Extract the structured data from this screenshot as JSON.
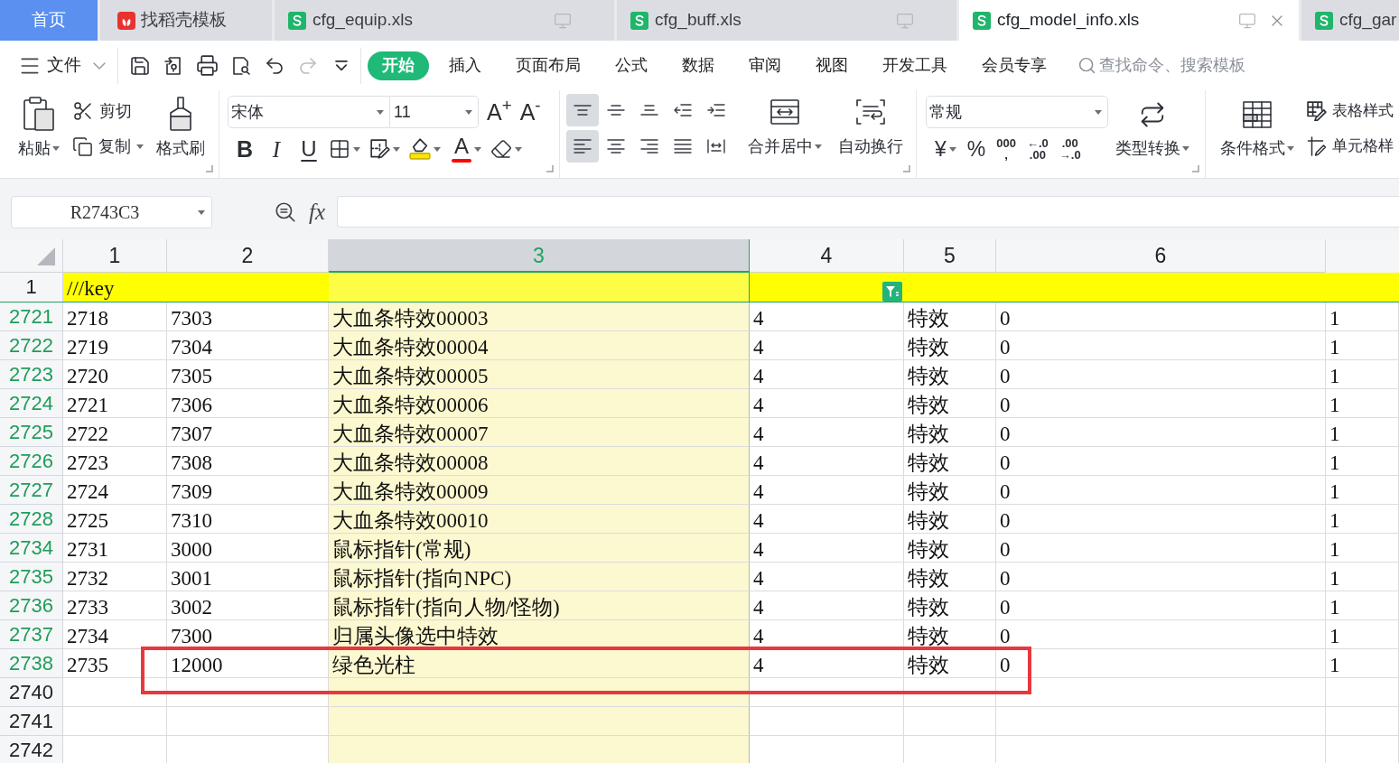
{
  "tabs": [
    {
      "kind": "home",
      "label": "首页",
      "selected": false
    },
    {
      "kind": "template",
      "label": "找稻壳模板",
      "selected": false
    },
    {
      "kind": "file",
      "label": "cfg_equip.xls",
      "selected": false
    },
    {
      "kind": "file",
      "label": "cfg_buff.xls",
      "selected": false
    },
    {
      "kind": "file",
      "label": "cfg_model_info.xls",
      "selected": true
    },
    {
      "kind": "file",
      "label": "cfg_gar",
      "selected": false
    }
  ],
  "menu_bar": {
    "file_menu": "文件",
    "history": [
      {
        "kind": "undo",
        "disabled": false
      },
      {
        "kind": "redo",
        "disabled": true
      }
    ],
    "items": [
      {
        "label": "开始",
        "selected": true
      },
      {
        "label": "插入",
        "selected": false
      },
      {
        "label": "页面布局",
        "selected": false
      },
      {
        "label": "公式",
        "selected": false
      },
      {
        "label": "数据",
        "selected": false
      },
      {
        "label": "审阅",
        "selected": false
      },
      {
        "label": "视图",
        "selected": false
      },
      {
        "label": "开发工具",
        "selected": false
      },
      {
        "label": "会员专享",
        "selected": false
      }
    ],
    "search": {
      "placeholder": "查找命令、搜索模板"
    }
  },
  "ribbon": {
    "clipboard": {
      "paste": "粘贴",
      "cut": "剪切",
      "copy": "复制",
      "format_painter": "格式刷"
    },
    "font": {
      "family": "宋体",
      "size": "11",
      "grow": "A$^{+}$",
      "shrink": "A$^{-}$",
      "bold": "B",
      "italic": "I",
      "underline": "U",
      "font_color": "A"
    },
    "alignment": {
      "buttons": [
        {
          "kind": "top",
          "selected": true
        },
        {
          "kind": "middle",
          "selected": false
        },
        {
          "kind": "bottom",
          "selected": false
        },
        {
          "kind": "outdent",
          "selected": false
        },
        {
          "kind": "indent",
          "selected": false
        },
        {
          "kind": "left",
          "selected": true
        },
        {
          "kind": "center",
          "selected": false
        },
        {
          "kind": "right",
          "selected": false
        },
        {
          "kind": "justify",
          "selected": false
        },
        {
          "kind": "distributed",
          "selected": false
        }
      ],
      "merge": "合并居中",
      "wrap": "自动换行"
    },
    "number": {
      "format": "常规",
      "buttons": [
        {
          "kind": "currency",
          "lines": [
            "¥"
          ]
        },
        {
          "kind": "percent",
          "lines": [
            "%"
          ]
        },
        {
          "kind": "thousands",
          "lines": [
            "000",
            ","
          ]
        },
        {
          "kind": "add_decimal",
          "lines": [
            "←.0",
            ".00"
          ]
        },
        {
          "kind": "remove_decimal",
          "lines": [
            ".00",
            "→.0"
          ]
        }
      ],
      "convert": "类型转换"
    },
    "styles": {
      "conditional": "条件格式",
      "table_style": "表格样式",
      "cell_style": "单元格样"
    }
  },
  "formula_bar": {
    "name_box": "R2743C3",
    "function_label": "fx"
  },
  "sheet": {
    "columns": [
      {
        "label": "1",
        "selected": false
      },
      {
        "label": "2",
        "selected": false
      },
      {
        "label": "3",
        "selected": true
      },
      {
        "label": "4",
        "selected": false
      },
      {
        "label": "5",
        "selected": false
      },
      {
        "label": "6",
        "selected": false
      }
    ],
    "header_row": {
      "number": "1",
      "key": "///key",
      "filter": true
    },
    "rows": [
      {
        "number": "2721",
        "filtered": true,
        "highlighted": false,
        "cells": [
          "2718",
          "7303",
          "大血条特效00003",
          "4",
          "特效",
          "0",
          "1"
        ]
      },
      {
        "number": "2722",
        "filtered": true,
        "highlighted": false,
        "cells": [
          "2719",
          "7304",
          "大血条特效00004",
          "4",
          "特效",
          "0",
          "1"
        ]
      },
      {
        "number": "2723",
        "filtered": true,
        "highlighted": false,
        "cells": [
          "2720",
          "7305",
          "大血条特效00005",
          "4",
          "特效",
          "0",
          "1"
        ]
      },
      {
        "number": "2724",
        "filtered": true,
        "highlighted": false,
        "cells": [
          "2721",
          "7306",
          "大血条特效00006",
          "4",
          "特效",
          "0",
          "1"
        ]
      },
      {
        "number": "2725",
        "filtered": true,
        "highlighted": false,
        "cells": [
          "2722",
          "7307",
          "大血条特效00007",
          "4",
          "特效",
          "0",
          "1"
        ]
      },
      {
        "number": "2726",
        "filtered": true,
        "highlighted": false,
        "cells": [
          "2723",
          "7308",
          "大血条特效00008",
          "4",
          "特效",
          "0",
          "1"
        ]
      },
      {
        "number": "2727",
        "filtered": true,
        "highlighted": false,
        "cells": [
          "2724",
          "7309",
          "大血条特效00009",
          "4",
          "特效",
          "0",
          "1"
        ]
      },
      {
        "number": "2728",
        "filtered": true,
        "highlighted": false,
        "cells": [
          "2725",
          "7310",
          "大血条特效00010",
          "4",
          "特效",
          "0",
          "1"
        ]
      },
      {
        "number": "2734",
        "filtered": true,
        "highlighted": false,
        "cells": [
          "2731",
          "3000",
          "鼠标指针(常规)",
          "4",
          "特效",
          "0",
          "1"
        ]
      },
      {
        "number": "2735",
        "filtered": true,
        "highlighted": false,
        "cells": [
          "2732",
          "3001",
          "鼠标指针(指向NPC)",
          "4",
          "特效",
          "0",
          "1"
        ]
      },
      {
        "number": "2736",
        "filtered": true,
        "highlighted": false,
        "cells": [
          "2733",
          "3002",
          "鼠标指针(指向人物/怪物)",
          "4",
          "特效",
          "0",
          "1"
        ]
      },
      {
        "number": "2737",
        "filtered": true,
        "highlighted": false,
        "cells": [
          "2734",
          "7300",
          "归属头像选中特效",
          "4",
          "特效",
          "0",
          "1"
        ]
      },
      {
        "number": "2738",
        "filtered": true,
        "highlighted": true,
        "cells": [
          "2735",
          "12000",
          "绿色光柱",
          "4",
          "特效",
          "0",
          "1"
        ]
      },
      {
        "number": "2740",
        "filtered": false,
        "highlighted": false
      },
      {
        "number": "2741",
        "filtered": false,
        "highlighted": false
      },
      {
        "number": "2742",
        "filtered": false,
        "highlighted": false
      }
    ]
  }
}
